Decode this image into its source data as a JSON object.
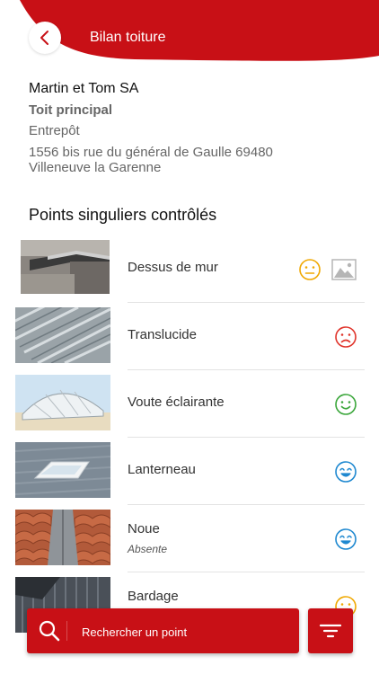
{
  "header": {
    "title": "Bilan toiture",
    "back_icon": "chevron-left-icon"
  },
  "site": {
    "company": "Martin et Tom SA",
    "roof": "Toit principal",
    "building": "Entrepôt",
    "address_line1": "1556 bis rue du général de Gaulle 69480",
    "address_line2": "Villeneuve la Garenne"
  },
  "section": {
    "title": "Points singuliers contrôlés"
  },
  "points": [
    {
      "label": "Dessus de mur",
      "sub": "",
      "status": "neutral",
      "status_icon": "neutral-face-icon",
      "has_photo": true
    },
    {
      "label": "Translucide",
      "sub": "",
      "status": "bad",
      "status_icon": "sad-face-icon",
      "has_photo": false
    },
    {
      "label": "Voute éclairante",
      "sub": "",
      "status": "good",
      "status_icon": "happy-face-icon",
      "has_photo": false
    },
    {
      "label": "Lanterneau",
      "sub": "",
      "status": "very-good",
      "status_icon": "very-happy-face-icon",
      "has_photo": false
    },
    {
      "label": "Noue",
      "sub": "Absente",
      "status": "very-good",
      "status_icon": "very-happy-face-icon",
      "has_photo": false
    },
    {
      "label": "Bardage",
      "sub": "",
      "status": "neutral",
      "status_icon": "neutral-face-icon",
      "has_photo": false
    }
  ],
  "search": {
    "placeholder": "Rechercher un point",
    "icon": "search-icon"
  },
  "filter": {
    "icon": "filter-icon"
  },
  "colors": {
    "brand_red": "#c81016",
    "neutral": "#f0a800",
    "bad": "#e0342b",
    "good": "#3aa63a",
    "very_good": "#1e88d0"
  }
}
